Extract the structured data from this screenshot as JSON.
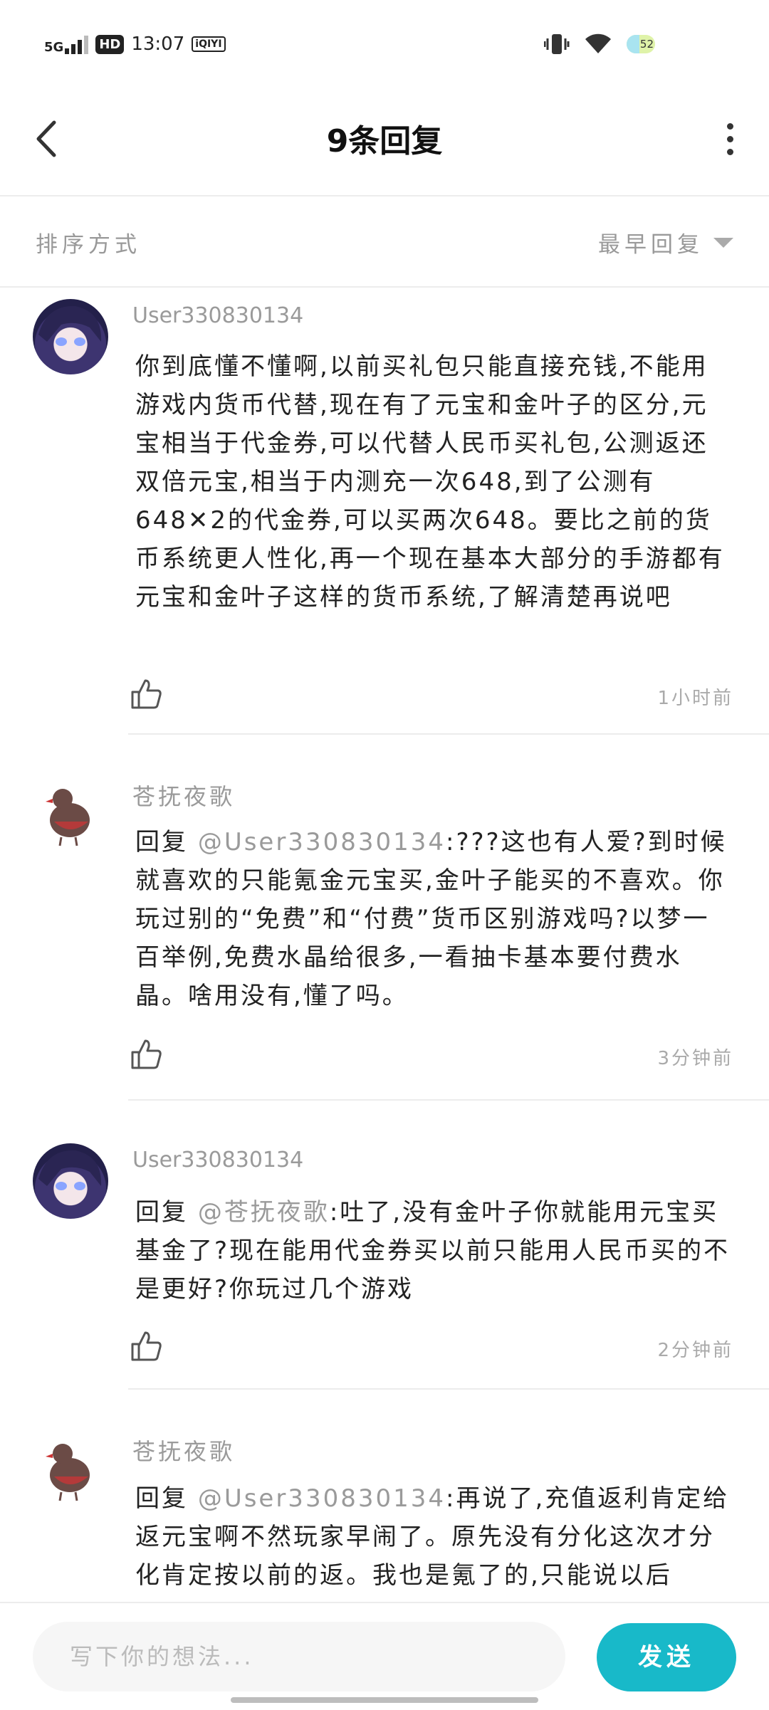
{
  "status_bar": {
    "network": "5G",
    "hd": "HD",
    "time": "13:07",
    "app_badge": "iQIYI",
    "battery": "52"
  },
  "header": {
    "title": "9条回复"
  },
  "sort": {
    "label": "排序方式",
    "value": "最早回复"
  },
  "comments": [
    {
      "username": "User330830134",
      "avatar": "anime-avatar",
      "mention": "",
      "body": "你到底懂不懂啊,以前买礼包只能直接充钱,不能用游戏内货币代替,现在有了元宝和金叶子的区分,元宝相当于代金券,可以代替人民币买礼包,公测返还双倍元宝,相当于内测充一次648,到了公测有648✕2的代金券,可以买两次648。要比之前的货币系统更人性化,再一个现在基本大部分的手游都有元宝和金叶子这样的货币系统,了解清楚再说吧",
      "time": "1小时前"
    },
    {
      "username": "苍抚夜歌",
      "avatar": "bird-avatar",
      "prefix": "回复",
      "mention": "@User330830134",
      "body": ":???这也有人爱?到时候就喜欢的只能氪金元宝买,金叶子能买的不喜欢。你玩过别的“免费”和“付费”货币区别游戏吗?以梦一百举例,免费水晶给很多,一看抽卡基本要付费水晶。啥用没有,懂了吗。",
      "time": "3分钟前"
    },
    {
      "username": "User330830134",
      "avatar": "anime-avatar",
      "prefix": "回复",
      "mention": "@苍抚夜歌",
      "body": ":吐了,没有金叶子你就能用元宝买基金了?现在能用代金券买以前只能用人民币买的不是更好?你玩过几个游戏",
      "time": "2分钟前"
    },
    {
      "username": "苍抚夜歌",
      "avatar": "bird-avatar",
      "prefix": "回复",
      "mention": "@User330830134",
      "body": ":再说了,充值返利肯定给返元宝啊不然玩家早闹了。原先没有分化这次才分化肯定按以前的返。我也是氪了的,只能说以后",
      "time": ""
    }
  ],
  "composer": {
    "placeholder": "写下你的想法...",
    "send_label": "发送"
  },
  "colors": {
    "accent": "#18b9c9",
    "muted": "#9a9a9a"
  }
}
